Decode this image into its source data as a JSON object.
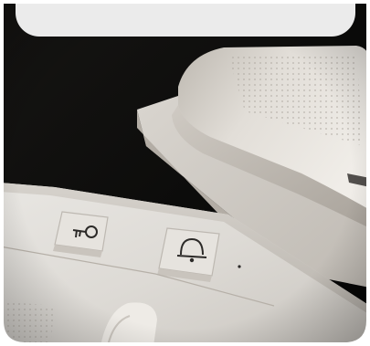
{
  "image": {
    "subject": "intercom-handset",
    "colors": {
      "background": "#0c0c0c",
      "device": "#d6d3cf",
      "top_card": "#ebebeb"
    }
  },
  "buttons": [
    {
      "icon": "key-icon"
    },
    {
      "icon": "bell-icon"
    }
  ]
}
